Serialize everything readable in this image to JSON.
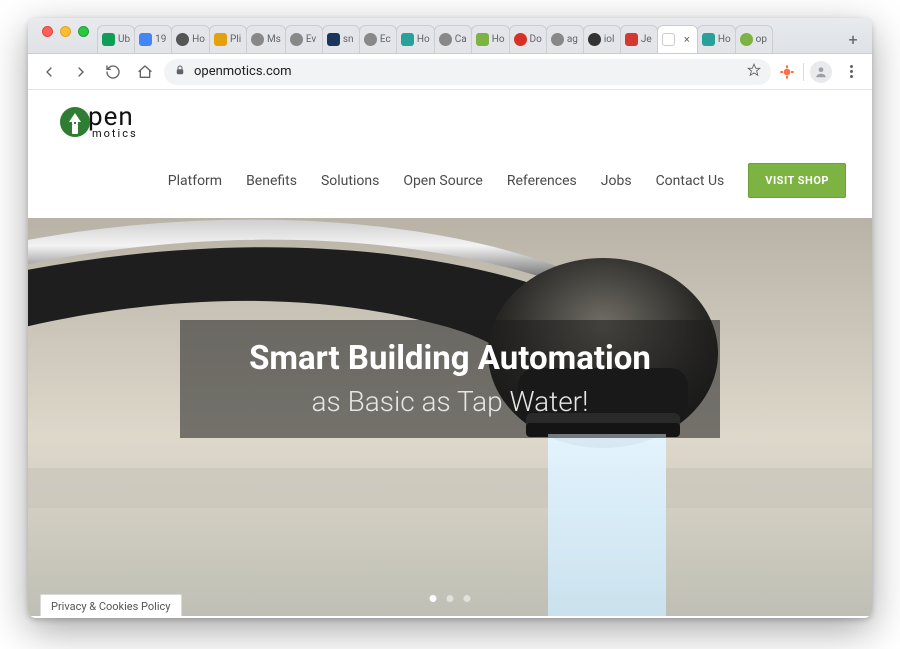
{
  "browser": {
    "tabs": [
      {
        "label": "Ub",
        "favicon": "gdrive",
        "color": "#0f9d58"
      },
      {
        "label": "19",
        "favicon": "gdocs",
        "color": "#4285f4"
      },
      {
        "label": "Ho",
        "favicon": "generic",
        "color": "#555"
      },
      {
        "label": "Pli",
        "favicon": "plex",
        "color": "#e5a00d"
      },
      {
        "label": "Ms",
        "favicon": "generic",
        "color": "#888"
      },
      {
        "label": "Ev",
        "favicon": "generic",
        "color": "#888"
      },
      {
        "label": "sn",
        "favicon": "square",
        "color": "#1b365d"
      },
      {
        "label": "Ec",
        "favicon": "generic",
        "color": "#888"
      },
      {
        "label": "Ho",
        "favicon": "square",
        "color": "#2aa198"
      },
      {
        "label": "Ca",
        "favicon": "generic",
        "color": "#888"
      },
      {
        "label": "Ho",
        "favicon": "square",
        "color": "#7cb342"
      },
      {
        "label": "Do",
        "favicon": "round",
        "color": "#d93025"
      },
      {
        "label": "ag",
        "favicon": "generic",
        "color": "#888"
      },
      {
        "label": "iol",
        "favicon": "round",
        "color": "#333"
      },
      {
        "label": "Je",
        "favicon": "square",
        "color": "#d33833"
      },
      {
        "label": "",
        "favicon": "blank",
        "color": "#bbb",
        "active": true,
        "closeable": true
      },
      {
        "label": "Ho",
        "favicon": "square",
        "color": "#2aa198"
      },
      {
        "label": "op",
        "favicon": "round",
        "color": "#7cb342"
      }
    ],
    "url": "openmotics.com"
  },
  "logo": {
    "word": "pen",
    "sub": "motics"
  },
  "nav": {
    "items": [
      {
        "label": "Platform"
      },
      {
        "label": "Benefits"
      },
      {
        "label": "Solutions"
      },
      {
        "label": "Open Source"
      },
      {
        "label": "References"
      },
      {
        "label": "Jobs"
      },
      {
        "label": "Contact Us"
      }
    ],
    "cta": "VISIT SHOP"
  },
  "hero": {
    "title": "Smart Building Automation",
    "subtitle": "as Basic as Tap Water!",
    "slide_count": 3,
    "active_slide": 0
  },
  "cookies_label": "Privacy & Cookies Policy",
  "colors": {
    "accent": "#7cb342"
  }
}
